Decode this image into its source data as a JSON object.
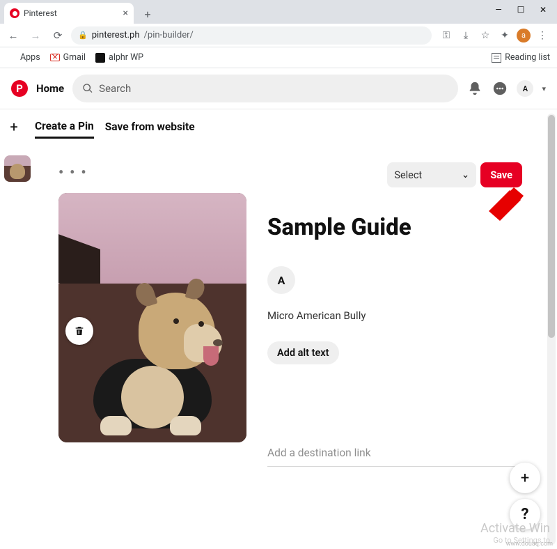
{
  "browser": {
    "tab_title": "Pinterest",
    "url_host": "pinterest.ph",
    "url_path": "/pin-builder/",
    "bookmarks": {
      "apps": "Apps",
      "gmail": "Gmail",
      "alphr": "alphr WP",
      "reading_list": "Reading list"
    },
    "avatar_letter": "a"
  },
  "header": {
    "home": "Home",
    "search_placeholder": "Search",
    "avatar_letter": "A"
  },
  "builder": {
    "tabs": {
      "create": "Create a Pin",
      "save_from_web": "Save from website"
    },
    "board_select": "Select",
    "save_button": "Save",
    "pin_title": "Sample Guide",
    "author_letter": "A",
    "description": "Micro American Bully",
    "alt_button": "Add alt text",
    "destination_placeholder": "Add a destination link"
  },
  "fab": {
    "plus": "+",
    "help": "?"
  },
  "watermark": {
    "line1": "Activate Win",
    "line2": "Go to Settings to",
    "source": "www.douaq.com"
  },
  "colors": {
    "accent": "#e60023"
  }
}
